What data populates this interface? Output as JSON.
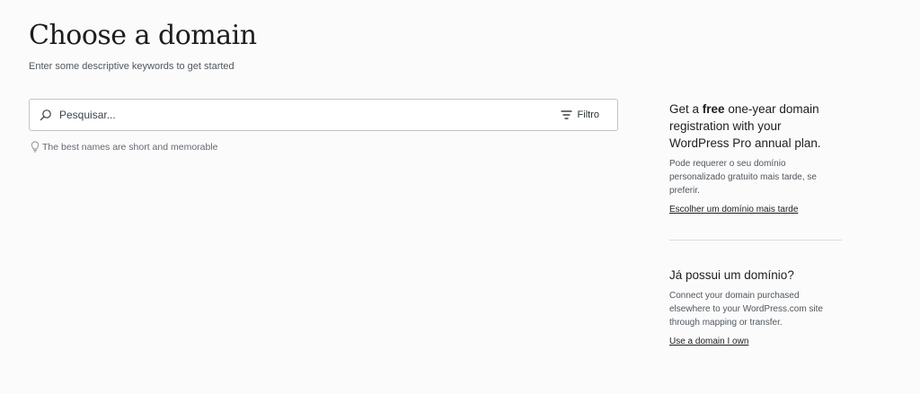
{
  "header": {
    "title": "Choose a domain",
    "subtitle": "Enter some descriptive keywords to get started"
  },
  "search": {
    "placeholder": "Pesquisar...",
    "value": "",
    "filter_label": "Filtro"
  },
  "hint": {
    "text": "The best names are short and memorable"
  },
  "sidebar": {
    "promo": {
      "title_prefix": "Get a",
      "title_bold": "free",
      "title_suffix": "one-year domain registration with your WordPress Pro annual plan.",
      "description": "Pode requerer o seu domínio personalizado gratuito mais tarde, se preferir.",
      "link_label": "Escolher um domínio mais tarde"
    },
    "own_domain": {
      "title": "Já possui um domínio?",
      "description": "Connect your domain purchased elsewhere to your WordPress.com site through mapping or transfer.",
      "link_label": "Use a domain I own"
    }
  },
  "icons": {
    "search": "search-icon",
    "filter": "filter-icon",
    "hint": "lightbulb-icon"
  },
  "colors": {
    "background": "#fbfbfb",
    "text": "#1e1e1e",
    "muted": "#50575e",
    "border": "#c3c4c7"
  }
}
